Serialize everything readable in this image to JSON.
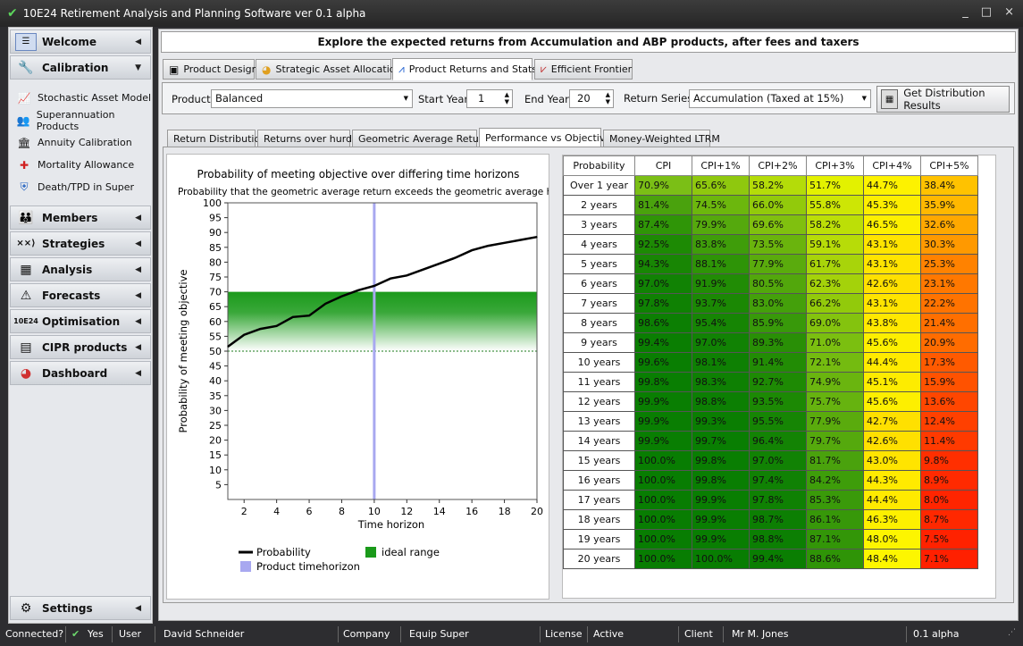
{
  "window": {
    "title": "10E24 Retirement Analysis and Planning Software ver 0.1 alpha",
    "minimize": "_",
    "maximize": "□",
    "close": "×"
  },
  "sidebar": {
    "groups_top": [
      {
        "label": "Welcome",
        "icon": "welcome-icon"
      },
      {
        "label": "Calibration",
        "icon": "calibration-icon"
      }
    ],
    "calibration_items": [
      {
        "label": "Stochastic Asset Model",
        "icon": "chart-line-icon"
      },
      {
        "label": "Superannuation Products",
        "icon": "people-icon"
      },
      {
        "label": "Annuity Calibration",
        "icon": "bank-icon"
      },
      {
        "label": "Mortality Allowance",
        "icon": "medical-kit-icon"
      },
      {
        "label": "Death/TPD in Super",
        "icon": "shield-icon"
      }
    ],
    "groups_bottom": [
      {
        "label": "Members",
        "icon": "members-icon"
      },
      {
        "label": "Strategies",
        "icon": "strategies-icon"
      },
      {
        "label": "Analysis",
        "icon": "analysis-icon"
      },
      {
        "label": "Forecasts",
        "icon": "forecasts-icon"
      },
      {
        "label": "Optimisation",
        "icon": "optimisation-icon"
      },
      {
        "label": "CIPR products",
        "icon": "cipr-icon"
      },
      {
        "label": "Dashboard",
        "icon": "dashboard-icon"
      }
    ],
    "settings": "Settings"
  },
  "banner": "Explore the expected returns from Accumulation and ABP products, after fees and taxers",
  "main_tabs": [
    "Product Design",
    "Strategic Asset Allocation",
    "Product Returns and Stats",
    "Efficient Frontier"
  ],
  "toolbar": {
    "product_label": "Product",
    "product_value": "Balanced",
    "start_label": "Start Year",
    "start_value": "1",
    "end_label": "End Year",
    "end_value": "20",
    "series_label": "Return Series",
    "series_value": "Accumulation (Taxed at 15%)",
    "get_button": "Get Distribution Results"
  },
  "sub_tabs": [
    "Return Distribution",
    "Returns over hurdle",
    "Geometric Average Returns",
    "Performance vs Objectives",
    "Money-Weighted LTRM"
  ],
  "chart_data": {
    "type": "line",
    "title": "Probability of meeting objective over differing time horizons",
    "subtitle": "Probability that the geometric average return exceeds the geometric average hurdle",
    "xlabel": "Time horizon",
    "ylabel": "Probability of meeting objective",
    "xlim": [
      1,
      20
    ],
    "ylim": [
      0,
      100
    ],
    "xticks": [
      2,
      4,
      6,
      8,
      10,
      12,
      14,
      16,
      18,
      20
    ],
    "yticks": [
      5,
      10,
      15,
      20,
      25,
      30,
      35,
      40,
      45,
      50,
      55,
      60,
      65,
      70,
      75,
      80,
      85,
      90,
      95,
      100
    ],
    "series": [
      {
        "name": "Probability",
        "x": [
          1,
          2,
          3,
          4,
          5,
          6,
          7,
          8,
          9,
          10,
          11,
          12,
          13,
          14,
          15,
          16,
          17,
          18,
          19,
          20
        ],
        "values": [
          51.5,
          55.5,
          57.5,
          58.5,
          61.5,
          62.0,
          66.0,
          68.5,
          70.5,
          72.0,
          74.5,
          75.5,
          77.5,
          79.5,
          81.5,
          84.0,
          85.5,
          86.5,
          87.5,
          88.5
        ]
      }
    ],
    "product_timehorizon": 10,
    "ideal_range": [
      50,
      70
    ],
    "legend": [
      {
        "label": "Probability",
        "color": "#000000"
      },
      {
        "label": "ideal range",
        "color": "#1a9a1a"
      },
      {
        "label": "Product timehorizon",
        "color": "#a8a8f0"
      }
    ]
  },
  "table": {
    "headers": [
      "Probability",
      "CPI",
      "CPI+1%",
      "CPI+2%",
      "CPI+3%",
      "CPI+4%",
      "CPI+5%"
    ],
    "rows": [
      {
        "label": "Over 1 year",
        "values": [
          "70.9%",
          "65.6%",
          "58.2%",
          "51.7%",
          "44.7%",
          "38.4%"
        ],
        "colors": [
          "#7bbf16",
          "#8fc80e",
          "#b4dc09",
          "#e3f100",
          "#fdf200",
          "#ffc200"
        ]
      },
      {
        "label": "2 years",
        "values": [
          "81.4%",
          "74.5%",
          "66.0%",
          "55.8%",
          "45.3%",
          "35.9%"
        ],
        "colors": [
          "#4aa20d",
          "#6cb70d",
          "#92ca0b",
          "#cde605",
          "#fdee00",
          "#ffb800"
        ]
      },
      {
        "label": "3 years",
        "values": [
          "87.4%",
          "79.9%",
          "69.6%",
          "58.2%",
          "46.5%",
          "32.6%"
        ],
        "colors": [
          "#2f9507",
          "#55a90d",
          "#80c00f",
          "#bcdf07",
          "#fdf000",
          "#ffa800"
        ]
      },
      {
        "label": "4 years",
        "values": [
          "92.5%",
          "83.8%",
          "73.5%",
          "59.1%",
          "43.1%",
          "30.3%"
        ],
        "colors": [
          "#1d8a04",
          "#3f9d0a",
          "#6ab40d",
          "#b7dc08",
          "#ffe400",
          "#ff9900"
        ]
      },
      {
        "label": "5 years",
        "values": [
          "94.3%",
          "88.1%",
          "77.9%",
          "61.7%",
          "43.1%",
          "25.3%"
        ],
        "colors": [
          "#188604",
          "#2e9407",
          "#5aab0d",
          "#a8d40a",
          "#ffe400",
          "#ff8200"
        ]
      },
      {
        "label": "6 years",
        "values": [
          "97.0%",
          "91.9%",
          "80.5%",
          "62.3%",
          "42.6%",
          "23.1%"
        ],
        "colors": [
          "#118204",
          "#218c05",
          "#52a70c",
          "#a4d20a",
          "#ffe000",
          "#ff7800"
        ]
      },
      {
        "label": "7 years",
        "values": [
          "97.8%",
          "93.7%",
          "83.0%",
          "66.2%",
          "43.1%",
          "22.2%"
        ],
        "colors": [
          "#0f8103",
          "#1b8804",
          "#44a00b",
          "#92ca0b",
          "#ffe400",
          "#ff7300"
        ]
      },
      {
        "label": "8 years",
        "values": [
          "98.6%",
          "95.4%",
          "85.9%",
          "69.0%",
          "43.8%",
          "21.4%"
        ],
        "colors": [
          "#0c7f03",
          "#168504",
          "#38990a",
          "#84c30e",
          "#ffe800",
          "#ff6f00"
        ]
      },
      {
        "label": "9 years",
        "values": [
          "99.4%",
          "97.0%",
          "89.3%",
          "71.0%",
          "45.6%",
          "20.9%"
        ],
        "colors": [
          "#0a7e02",
          "#118204",
          "#298f06",
          "#7bbf10",
          "#fdef00",
          "#ff6c00"
        ]
      },
      {
        "label": "10 years",
        "values": [
          "99.6%",
          "98.1%",
          "91.4%",
          "72.1%",
          "44.4%",
          "17.3%"
        ],
        "colors": [
          "#097e02",
          "#0e8003",
          "#228c05",
          "#74bb10",
          "#ffea00",
          "#ff5a00"
        ]
      },
      {
        "label": "11 years",
        "values": [
          "99.8%",
          "98.3%",
          "92.7%",
          "74.9%",
          "45.1%",
          "15.9%"
        ],
        "colors": [
          "#097e02",
          "#0e8003",
          "#1e8a04",
          "#6ab50f",
          "#fdec00",
          "#ff5200"
        ]
      },
      {
        "label": "12 years",
        "values": [
          "99.9%",
          "98.8%",
          "93.5%",
          "75.7%",
          "45.6%",
          "13.6%"
        ],
        "colors": [
          "#097e02",
          "#0c7f03",
          "#1c8904",
          "#66b30f",
          "#fdef00",
          "#ff4600"
        ]
      },
      {
        "label": "13 years",
        "values": [
          "99.9%",
          "99.3%",
          "95.5%",
          "77.9%",
          "42.7%",
          "12.4%"
        ],
        "colors": [
          "#097e02",
          "#0a7e02",
          "#168504",
          "#5aab0d",
          "#ffe000",
          "#ff4000"
        ]
      },
      {
        "label": "14 years",
        "values": [
          "99.9%",
          "99.7%",
          "96.4%",
          "79.7%",
          "42.6%",
          "11.4%"
        ],
        "colors": [
          "#097e02",
          "#097e02",
          "#138304",
          "#55a90d",
          "#ffe000",
          "#ff3a00"
        ]
      },
      {
        "label": "15 years",
        "values": [
          "100.0%",
          "99.8%",
          "97.0%",
          "81.7%",
          "43.0%",
          "9.8%"
        ],
        "colors": [
          "#087d02",
          "#097e02",
          "#118204",
          "#4aa20d",
          "#ffe400",
          "#ff2f00"
        ]
      },
      {
        "label": "16 years",
        "values": [
          "100.0%",
          "99.8%",
          "97.4%",
          "84.2%",
          "44.3%",
          "8.9%"
        ],
        "colors": [
          "#087d02",
          "#097e02",
          "#108104",
          "#3e9d0a",
          "#ffea00",
          "#ff2a00"
        ]
      },
      {
        "label": "17 years",
        "values": [
          "100.0%",
          "99.9%",
          "97.8%",
          "85.3%",
          "44.4%",
          "8.0%"
        ],
        "colors": [
          "#087d02",
          "#097e02",
          "#0f8103",
          "#3a9a0a",
          "#ffea00",
          "#ff2500"
        ]
      },
      {
        "label": "18 years",
        "values": [
          "100.0%",
          "99.9%",
          "98.7%",
          "86.1%",
          "46.3%",
          "8.7%"
        ],
        "colors": [
          "#087d02",
          "#097e02",
          "#0c7f03",
          "#379809",
          "#fdf000",
          "#ff2800"
        ]
      },
      {
        "label": "19 years",
        "values": [
          "100.0%",
          "99.9%",
          "98.8%",
          "87.1%",
          "48.0%",
          "7.5%"
        ],
        "colors": [
          "#087d02",
          "#097e02",
          "#0c7f03",
          "#339608",
          "#fdf500",
          "#ff2200"
        ]
      },
      {
        "label": "20 years",
        "values": [
          "100.0%",
          "100.0%",
          "99.4%",
          "88.6%",
          "48.4%",
          "7.1%"
        ],
        "colors": [
          "#087d02",
          "#087d02",
          "#0a7e02",
          "#2f9407",
          "#fdf600",
          "#ff2000"
        ]
      }
    ]
  },
  "status": {
    "connected_label": "Connected?",
    "connected_value": "Yes",
    "user_label": "User",
    "user_value": "David Schneider",
    "company_label": "Company",
    "company_value": "Equip Super",
    "license_label": "License",
    "license_value": "Active",
    "client_label": "Client",
    "client_value": "Mr M. Jones",
    "version": "0.1 alpha"
  }
}
